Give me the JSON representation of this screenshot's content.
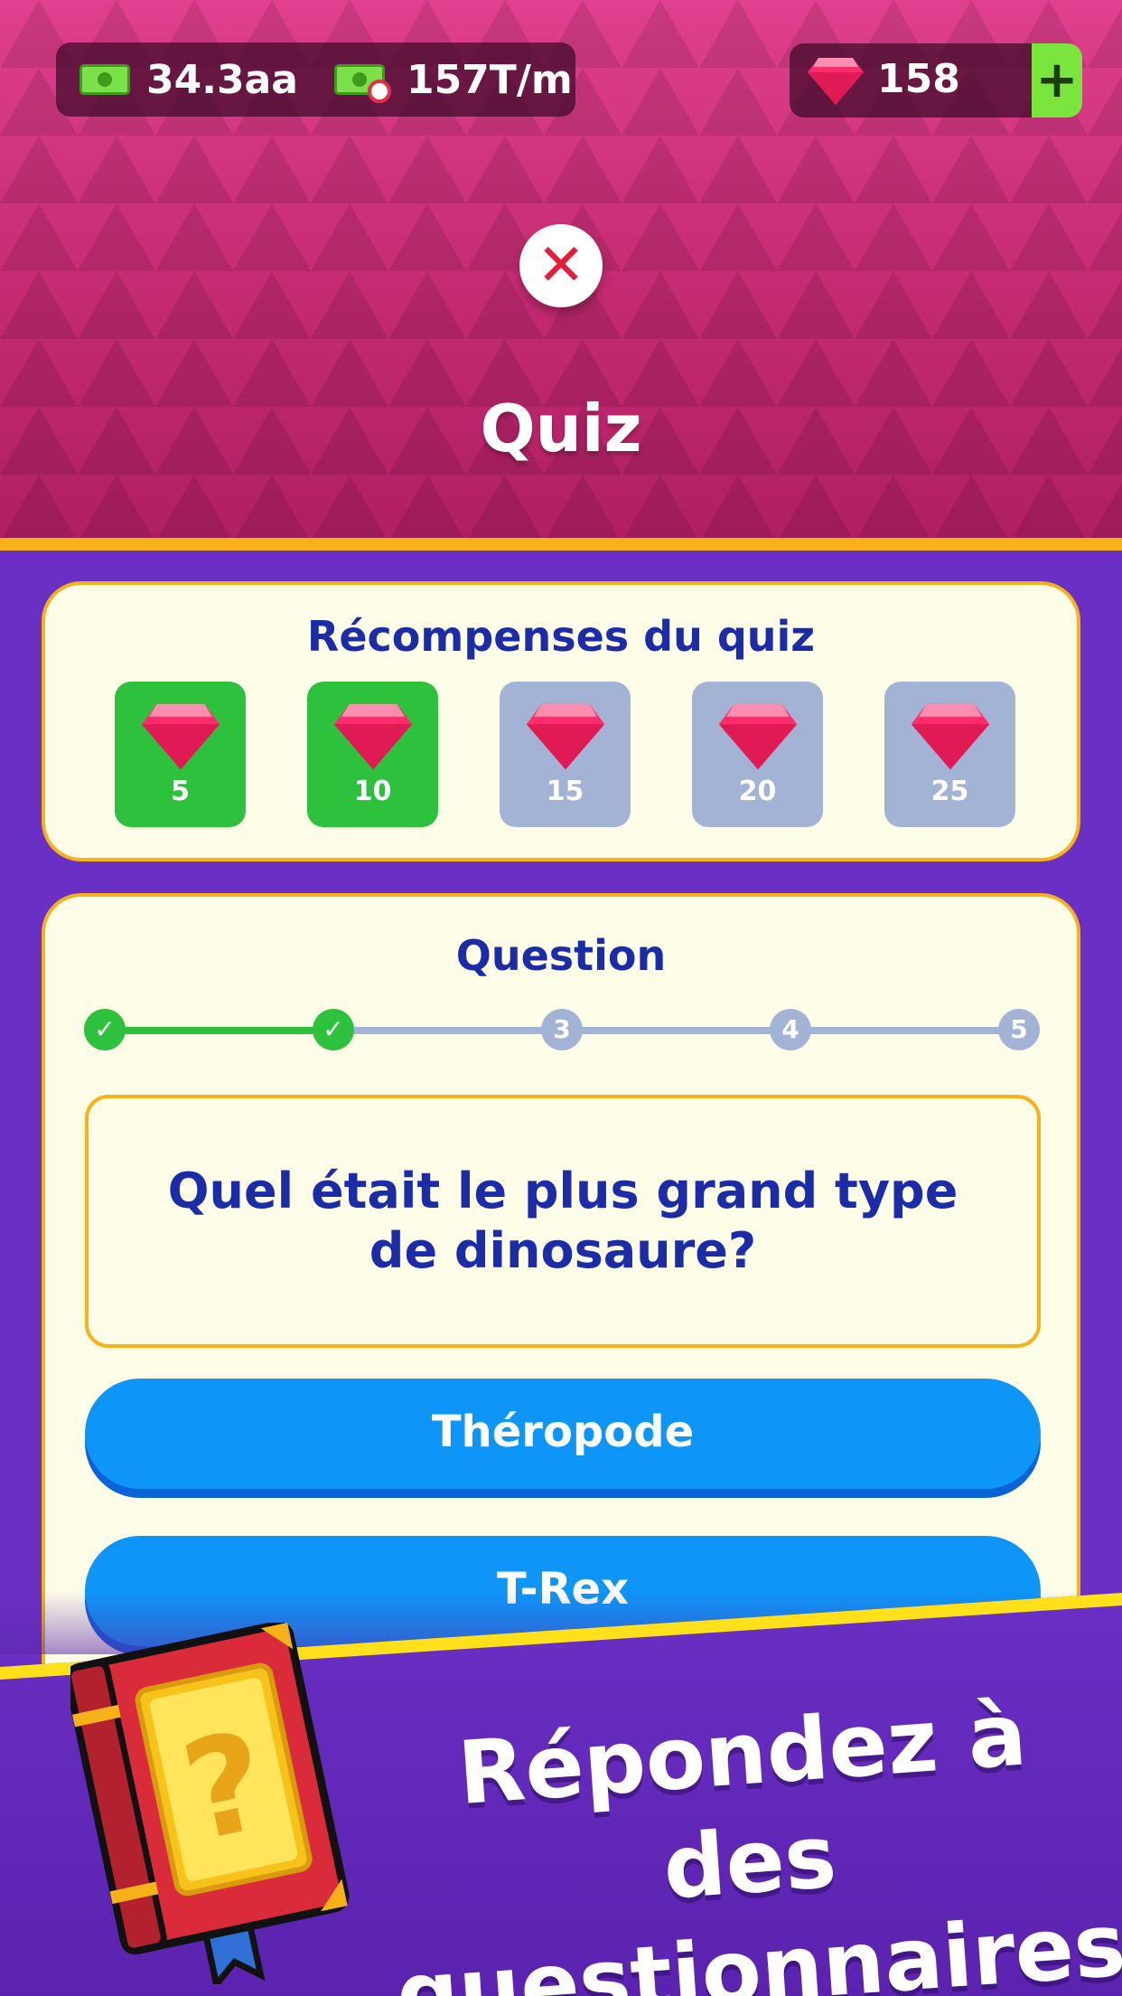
{
  "status_bar": {
    "cash_amount": "34.3aa",
    "income_rate": "157T/m",
    "gems": "158",
    "add_gems_symbol": "+"
  },
  "header": {
    "close_symbol": "✕",
    "title": "Quiz"
  },
  "rewards": {
    "title": "Récompenses du quiz",
    "items": [
      {
        "value": "5",
        "earned": true
      },
      {
        "value": "10",
        "earned": true
      },
      {
        "value": "15",
        "earned": false
      },
      {
        "value": "20",
        "earned": false
      },
      {
        "value": "25",
        "earned": false
      }
    ]
  },
  "question": {
    "title": "Question",
    "steps": [
      {
        "label": "✓",
        "done": true
      },
      {
        "label": "✓",
        "done": true
      },
      {
        "label": "3",
        "done": false
      },
      {
        "label": "4",
        "done": false
      },
      {
        "label": "5",
        "done": false
      }
    ],
    "text": "Quel était le plus grand type de dinosaure?",
    "answers": [
      "Théropode",
      "T-Rex"
    ]
  },
  "promo": {
    "line1": "Répondez à des",
    "line2": "questionnaires",
    "book_symbol": "?"
  },
  "colors": {
    "header_pink": "#e0408f",
    "gold": "#f7b21a",
    "card_cream": "#fefde8",
    "title_blue": "#1c2ba8",
    "earned_green": "#2dc13d",
    "locked_gray": "#a3b3d6",
    "answer_blue": "#0d96f7",
    "background_purple": "#6a2fc4"
  }
}
